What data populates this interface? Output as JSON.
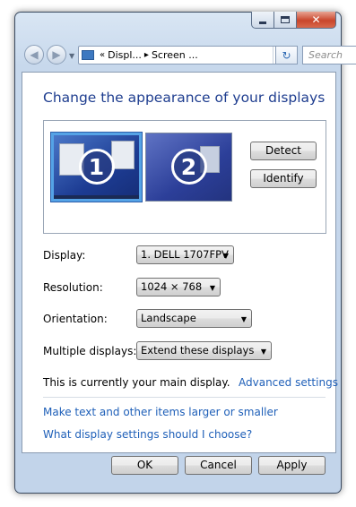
{
  "window": {
    "controls": {
      "minimize": "minimize",
      "maximize": "maximize",
      "close": "close"
    }
  },
  "navbar": {
    "address_breadcrumb": [
      "Displ...",
      "Screen ..."
    ],
    "search_placeholder": "Search"
  },
  "main": {
    "title": "Change the appearance of your displays",
    "monitors": [
      {
        "number": "1",
        "selected": true
      },
      {
        "number": "2",
        "selected": false
      }
    ],
    "detect_label": "Detect",
    "identify_label": "Identify",
    "settings": [
      {
        "label": "Display:",
        "value": "1. DELL 1707FPV"
      },
      {
        "label": "Resolution:",
        "value": "1024 × 768"
      },
      {
        "label": "Orientation:",
        "value": "Landscape"
      },
      {
        "label": "Multiple displays:",
        "value": "Extend these displays"
      }
    ],
    "main_display_text": "This is currently your main display.",
    "advanced_link": "Advanced settings",
    "links": [
      "Make text and other items larger or smaller",
      "What display settings should I choose?"
    ]
  },
  "footer": {
    "ok": "OK",
    "cancel": "Cancel",
    "apply": "Apply"
  },
  "colors": {
    "title": "#1e3d8f",
    "link": "#1e5fb8",
    "selection": "#55a3e6"
  }
}
